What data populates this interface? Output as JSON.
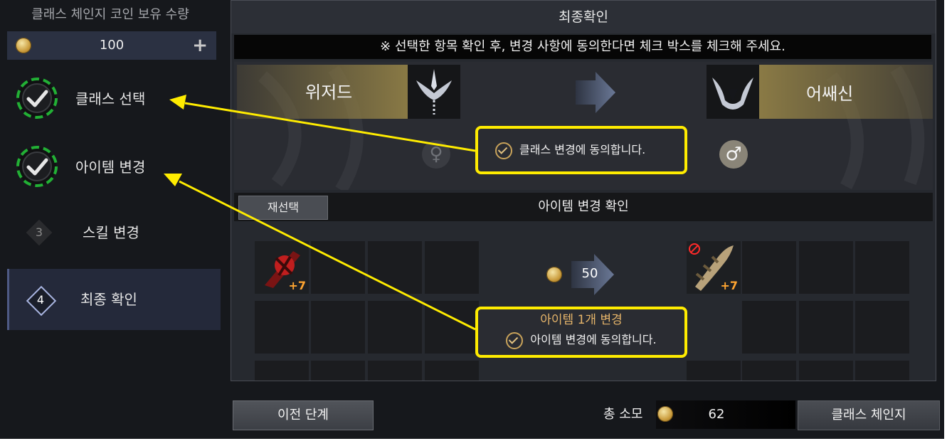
{
  "sidebar": {
    "coin_title": "클래스 체인지 코인 보유 수량",
    "coin_count": "100",
    "plus_label": "+",
    "steps": [
      {
        "label": "클래스 선택",
        "state": "done"
      },
      {
        "label": "아이템 변경",
        "state": "done"
      },
      {
        "number": "3",
        "label": "스킬 변경",
        "state": "inactive"
      },
      {
        "number": "4",
        "label": "최종 확인",
        "state": "active"
      }
    ]
  },
  "main": {
    "title": "최종확인",
    "notice": "※ 선택한 항목 확인 후, 변경 사항에 동의한다면 체크 박스를 체크해 주세요.",
    "class_change": {
      "from": "위저드",
      "to": "어쌔신",
      "from_gender": "♀",
      "to_gender": "♂",
      "consent": "클래스 변경에 동의합니다."
    },
    "item_section": {
      "reselect_label": "재선택",
      "title": "아이템 변경 확인",
      "from_enhance": "+7",
      "to_enhance": "+7",
      "cost": "50",
      "summary": "아이템 1개 변경",
      "consent": "아이템 변경에 동의합니다."
    }
  },
  "footer": {
    "prev_label": "이전 단계",
    "total_label": "총 소모",
    "total_value": "62",
    "submit_label": "클래스 체인지"
  },
  "colors": {
    "annotation": "#ffec00",
    "check_ring": "#22b035",
    "gold_banner": "#8a7a45",
    "enhance": "#ffa531"
  }
}
